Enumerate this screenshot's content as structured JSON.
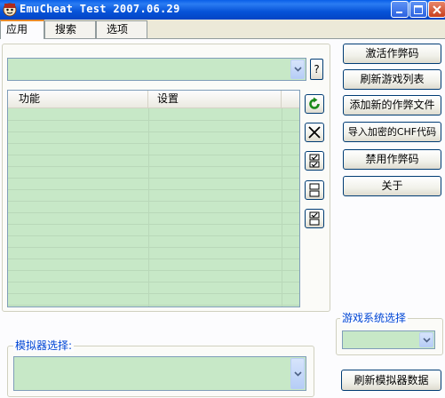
{
  "window": {
    "title": "EmuCheat Test 2007.06.29"
  },
  "tabs": [
    {
      "label": "应用",
      "active": true
    },
    {
      "label": "搜索",
      "active": false
    },
    {
      "label": "选项",
      "active": false
    }
  ],
  "cheat_combo": {
    "value": "",
    "help_label": "?"
  },
  "cheat_list": {
    "columns": [
      "功能",
      "设置"
    ],
    "rows": []
  },
  "side_icons": [
    "refresh-icon",
    "delete-icon",
    "check-list-icon",
    "uncheck-list-icon",
    "invert-check-icon"
  ],
  "buttons": {
    "activate": "激活作弊码",
    "refresh_games": "刷新游戏列表",
    "add_new": "添加新的作弊文件",
    "import_chf": "导入加密的CHF代码",
    "disable": "禁用作弊码",
    "about": "关于",
    "refresh_emulator": "刷新模拟器数据"
  },
  "emulator_group": {
    "caption": "模拟器选择:",
    "value": ""
  },
  "game_system_group": {
    "caption": "游戏系统选择",
    "value": ""
  },
  "colors": {
    "titlebar": "#0653d8",
    "list_background": "#c7e8c7",
    "group_caption": "#0046d5",
    "tab_highlight": "#e68b2c"
  }
}
